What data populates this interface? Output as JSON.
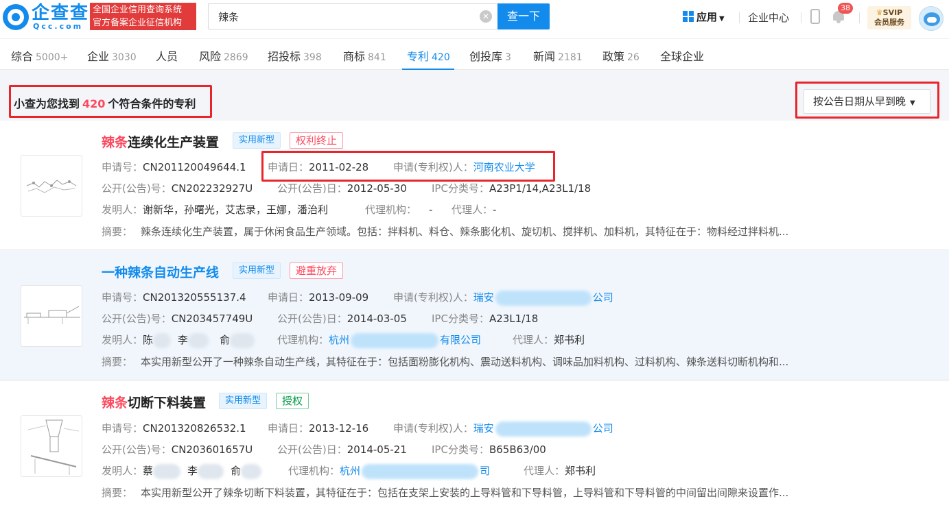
{
  "header": {
    "logo_name": "企查查",
    "logo_domain": "Qcc.com",
    "logo_badge_line1": "全国企业信用查询系统",
    "logo_badge_line2": "官方备案企业征信机构",
    "search_value": "辣条",
    "search_button": "查一下",
    "apps_label": "应用",
    "enterprise_center": "企业中心",
    "notification_count": "38",
    "svip_label": "SVIP",
    "svip_sub": "会员服务"
  },
  "tabs": [
    {
      "label": "综合",
      "count": "5000+"
    },
    {
      "label": "企业",
      "count": "3030"
    },
    {
      "label": "人员",
      "count": ""
    },
    {
      "label": "风险",
      "count": "2869"
    },
    {
      "label": "招投标",
      "count": "398"
    },
    {
      "label": "商标",
      "count": "841"
    },
    {
      "label": "专利",
      "count": "420"
    },
    {
      "label": "创投库",
      "count": "3"
    },
    {
      "label": "新闻",
      "count": "2181"
    },
    {
      "label": "政策",
      "count": "26"
    },
    {
      "label": "全球企业",
      "count": ""
    }
  ],
  "result": {
    "prefix": "小查为您找到",
    "count": "420",
    "suffix": "个符合条件的专利",
    "sort_label": "按公告日期从早到晚"
  },
  "labels": {
    "app_no": "申请号：",
    "app_date": "申请日：",
    "applicant": "申请(专利权)人：",
    "pub_no": "公开(公告)号：",
    "pub_date": "公开(公告)日：",
    "ipc": "IPC分类号：",
    "inventor": "发明人：",
    "agency": "代理机构：",
    "agent": "代理人：",
    "abstract": "摘要："
  },
  "patents": [
    {
      "title_kw": "辣条",
      "title_rest": "连续化生产装置",
      "type": "实用新型",
      "status": "权利终止",
      "app_no": "CN201120049644.1",
      "app_date": "2011-02-28",
      "applicant": "河南农业大学",
      "pub_no": "CN202232927U",
      "pub_date": "2012-05-30",
      "ipc": "A23P1/14,A23L1/18",
      "inventors": "谢新华，孙曙光，艾志录，王娜，潘治利",
      "agency": "-",
      "agent": "-",
      "abstract": "辣条连续化生产装置，属于休闲食品生产领域。包括：拌料机、料仓、辣条膨化机、旋切机、搅拌机、加料机，其特征在于：物料经过拌料机..."
    },
    {
      "title_kw": "",
      "title_rest": "一种辣条自动生产线",
      "type": "实用新型",
      "status": "避重放弃",
      "app_no": "CN201320555137.4",
      "app_date": "2013-09-09",
      "applicant_a": "瑞安",
      "applicant_b": "公司",
      "pub_no": "CN203457749U",
      "pub_date": "2014-03-05",
      "ipc": "A23L1/18",
      "inv1": "陈",
      "inv2": "李",
      "inv3": "俞",
      "agency_a": "杭州",
      "agency_b": "有限公司",
      "agent": "郑书利",
      "abstract": "本实用新型公开了一种辣条自动生产线，其特征在于：包括面粉膨化机构、震动送料机构、调味品加料机构、过料机构、辣条送料切断机构和..."
    },
    {
      "title_kw": "辣条",
      "title_rest": "切断下料装置",
      "type": "实用新型",
      "status": "授权",
      "app_no": "CN201320826532.1",
      "app_date": "2013-12-16",
      "applicant_a": "瑞安",
      "applicant_b": "公司",
      "pub_no": "CN203601657U",
      "pub_date": "2014-05-21",
      "ipc": "B65B63/00",
      "inv1": "蔡",
      "inv2": "李",
      "inv3": "俞",
      "agency_a": "杭州",
      "agency_b": "司",
      "agent": "郑书利",
      "abstract": "本实用新型公开了辣条切断下料装置，其特征在于：包括在支架上安装的上导料管和下导料管，上导料管和下导料管的中间留出间隙来设置作..."
    }
  ],
  "colors": {
    "brand": "#128bed",
    "highlight": "#fd485e",
    "annotation": "#e8252b"
  }
}
